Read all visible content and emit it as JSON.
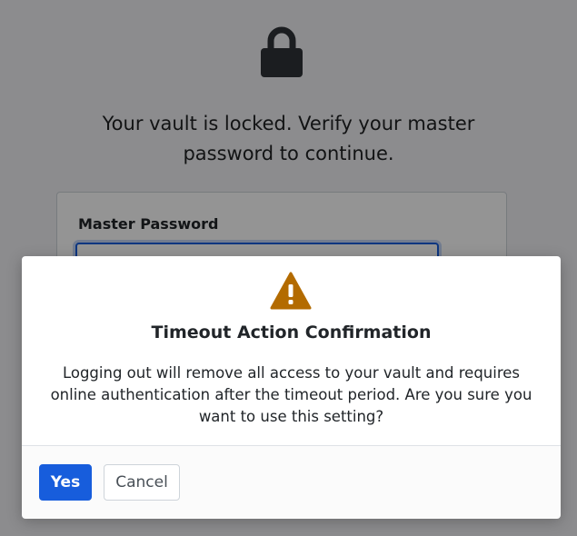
{
  "lock_screen": {
    "icon": "lock-icon",
    "message": "Your vault is locked. Verify your master password to continue.",
    "master_password_label": "Master Password",
    "master_password_value": ""
  },
  "modal": {
    "icon": "warning-icon",
    "icon_color": "#b36b00",
    "title": "Timeout Action Confirmation",
    "body": "Logging out will remove all access to your vault and requires online authentication after the timeout period. Are you sure you want to use this setting?",
    "yes_label": "Yes",
    "cancel_label": "Cancel"
  },
  "colors": {
    "primary": "#175ddc",
    "lock_icon": "#2f3337"
  }
}
